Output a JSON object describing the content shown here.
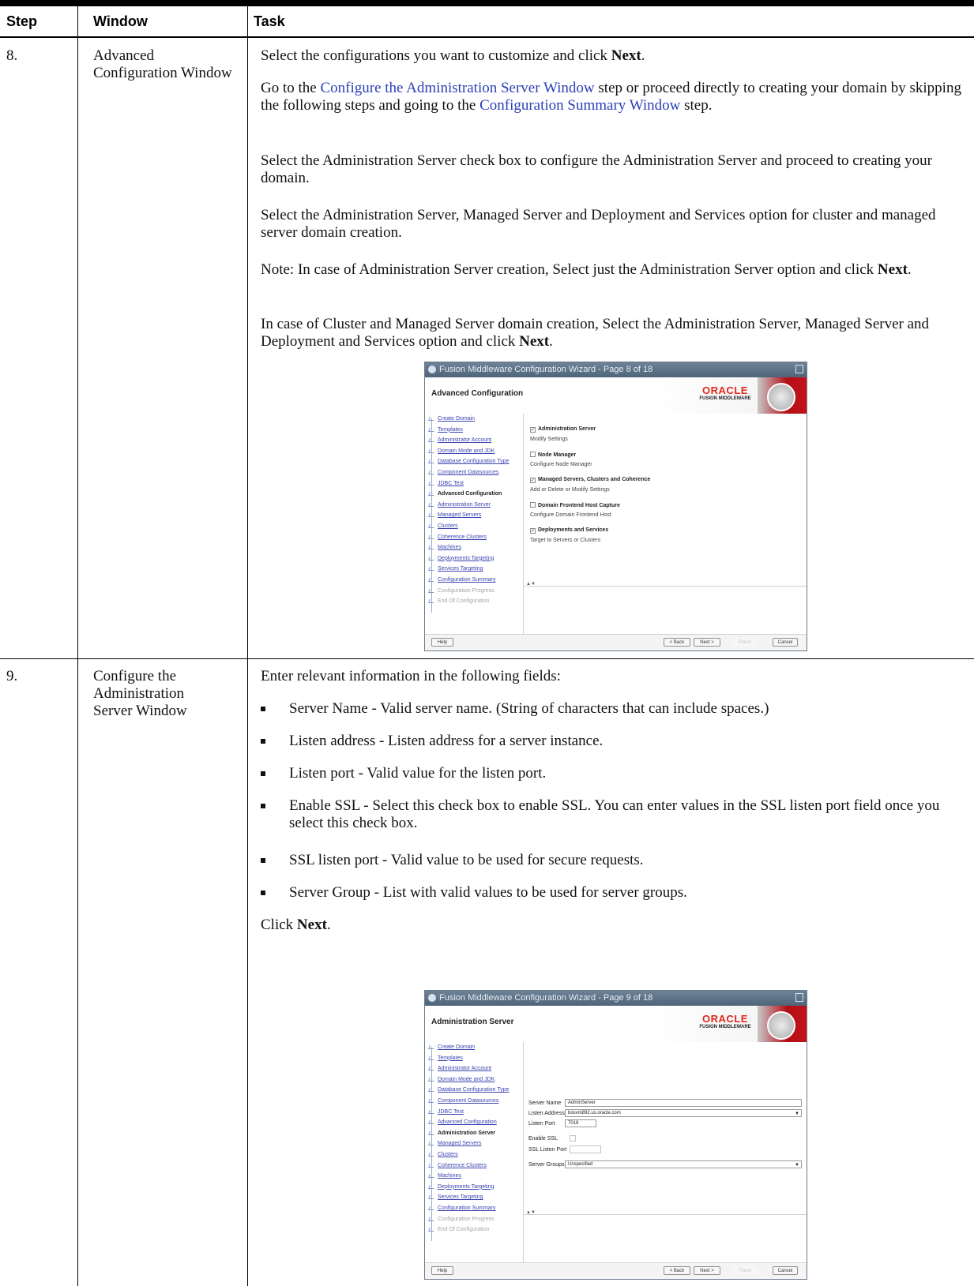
{
  "table": {
    "headers": {
      "step": "Step",
      "window": "Window",
      "task": "Task"
    }
  },
  "rows": [
    {
      "step": "8.",
      "window": "Advanced Configuration Window",
      "paragraphs": {
        "p1_pre": "Select the configurations you want to customize and click ",
        "p1_bold": "Next",
        "p1_post": ".",
        "p2_pre": "Go to the ",
        "p2_link1": "Configure the Administration Server Window",
        "p2_mid": " step or proceed directly to creating your domain by skipping the following steps and going to the ",
        "p2_link2": "Configuration Summary Window",
        "p2_post": " step.",
        "p3": "Select the Administration Server check box to configure the Administration Server and proceed to creating your domain.",
        "p4": "Select the Administration Server, Managed Server and Deployment and Services option for cluster and managed server domain creation.",
        "p5_pre": "Note: In case of Administration Server creation, Select just the Administration Server option and click ",
        "p5_bold": "Next",
        "p5_post": ".",
        "p6_pre": "In case of Cluster and Managed Server domain creation, Select the Administration Server, Managed Server and Deployment and Services option and click ",
        "p6_bold": "Next",
        "p6_post": "."
      },
      "wizard": {
        "title": "Fusion Middleware Configuration Wizard - Page 8 of 18",
        "header": "Advanced Configuration",
        "logo_main": "ORACLE",
        "logo_sub": "FUSION MIDDLEWARE",
        "nav": [
          "Create Domain",
          "Templates",
          "Administrator Account",
          "Domain Mode and JDK",
          "Database Configuration Type",
          "Component Datasources",
          "JDBC Test",
          "Advanced Configuration",
          "Administration Server",
          "Managed Servers",
          "Clusters",
          "Coherence Clusters",
          "Machines",
          "Deployments Targeting",
          "Services Targeting",
          "Configuration Summary",
          "Configuration Progress",
          "End Of Configuration"
        ],
        "current_index": 7,
        "options": [
          {
            "label": "Administration Server",
            "sub": "Modify Settings",
            "checked": true
          },
          {
            "label": "Node Manager",
            "sub": "Configure Node Manager",
            "checked": false
          },
          {
            "label": "Managed Servers, Clusters and Coherence",
            "sub": "Add or Delete or Modify Settings",
            "checked": true
          },
          {
            "label": "Domain Frontend Host Capture",
            "sub": "Configure Domain Frontend Host",
            "checked": false
          },
          {
            "label": "Deployments and Services",
            "sub": "Target to Servers or Clusters",
            "checked": true
          }
        ],
        "buttons": {
          "help": "Help",
          "back": "< Back",
          "next": "Next >",
          "finish": "Finish",
          "cancel": "Cancel"
        }
      }
    },
    {
      "step": "9.",
      "window": "Configure the Administration Server Window",
      "intro": "Enter relevant information in the following fields:",
      "bullets": [
        "Server Name - Valid server name. (String of characters that can include spaces.)",
        "Listen address - Listen address for a server instance.",
        "Listen port - Valid value for the listen port.",
        "Enable SSL - Select this check box to enable SSL. You can enter values in the SSL listen port field once you select this check box.",
        "SSL listen port - Valid value to be used for secure requests.",
        "Server Group - List with valid values to be used for server groups."
      ],
      "click_pre": "Click ",
      "click_bold": "Next",
      "click_post": ".",
      "wizard": {
        "title": "Fusion Middleware Configuration Wizard - Page 9 of 18",
        "header": "Administration Server",
        "logo_main": "ORACLE",
        "logo_sub": "FUSION MIDDLEWARE",
        "nav": [
          "Create Domain",
          "Templates",
          "Administrator Account",
          "Domain Mode and JDK",
          "Database Configuration Type",
          "Component Datasources",
          "JDBC Test",
          "Advanced Configuration",
          "Administration Server",
          "Managed Servers",
          "Clusters",
          "Coherence Clusters",
          "Machines",
          "Deployments Targeting",
          "Services Targeting",
          "Configuration Summary",
          "Configuration Progress",
          "End Of Configuration"
        ],
        "current_index": 8,
        "fields": {
          "server_name_label": "Server Name",
          "server_name_value": "AdminServer",
          "listen_address_label": "Listen Address",
          "listen_address_value": "bosvm892.us.oracle.com",
          "listen_port_label": "Listen Port",
          "listen_port_value": "7018",
          "enable_ssl_label": "Enable SSL",
          "ssl_port_label": "SSL Listen Port",
          "server_groups_label": "Server Groups",
          "server_groups_value": "Unspecified"
        },
        "buttons": {
          "help": "Help",
          "back": "< Back",
          "next": "Next >",
          "finish": "Finish",
          "cancel": "Cancel"
        }
      }
    }
  ]
}
